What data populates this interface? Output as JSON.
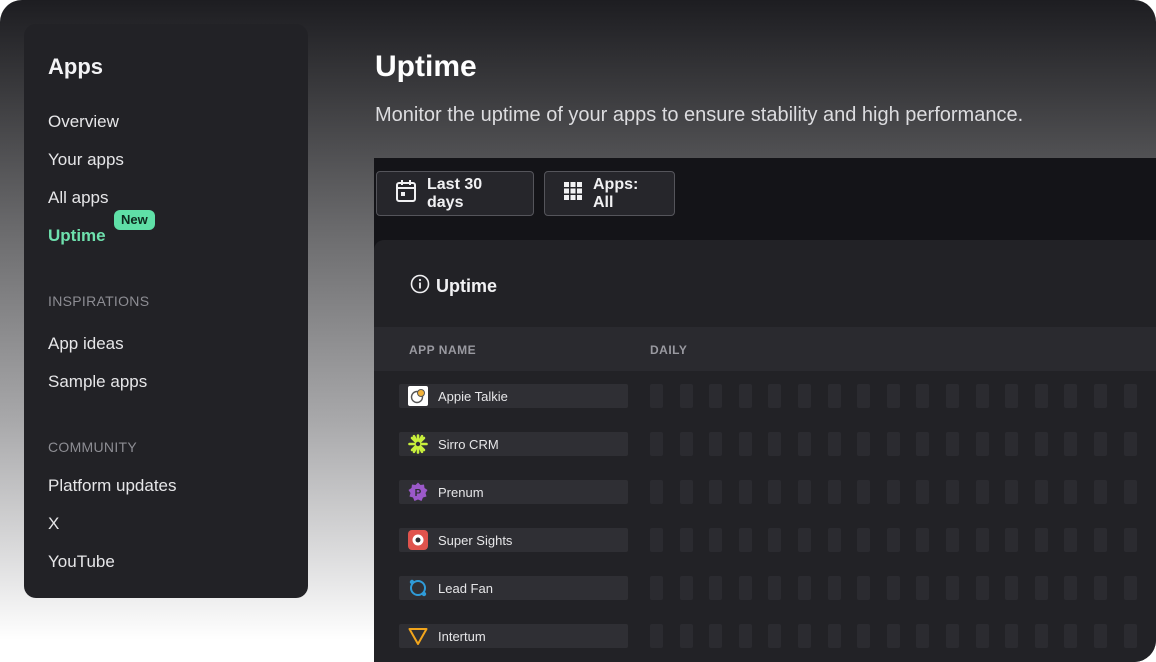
{
  "sidebar": {
    "title": "Apps",
    "items": [
      {
        "label": "Overview"
      },
      {
        "label": "Your apps"
      },
      {
        "label": "All apps"
      },
      {
        "label": "Uptime",
        "active": true,
        "badge": "New"
      }
    ],
    "sections": [
      {
        "title": "INSPIRATIONS",
        "items": [
          {
            "label": "App ideas"
          },
          {
            "label": "Sample apps"
          }
        ]
      },
      {
        "title": "COMMUNITY",
        "items": [
          {
            "label": "Platform updates"
          },
          {
            "label": "X"
          },
          {
            "label": "YouTube"
          }
        ]
      }
    ]
  },
  "main": {
    "title": "Uptime",
    "subtitle": "Monitor the uptime of your apps to ensure stability and high performance.",
    "filters": {
      "date_range": {
        "label": "Last 30 days",
        "icon": "calendar-icon"
      },
      "apps": {
        "label": "Apps: All",
        "icon": "grid-icon"
      }
    },
    "card": {
      "title": "Uptime",
      "title_icon": "info-icon",
      "columns": [
        "APP NAME",
        "DAILY"
      ],
      "rows": [
        {
          "name": "Appie Talkie",
          "logo": "appie-talkie-logo-icon"
        },
        {
          "name": "Sirro CRM",
          "logo": "sirro-crm-logo-icon"
        },
        {
          "name": "Prenum",
          "logo": "prenum-logo-icon"
        },
        {
          "name": "Super Sights",
          "logo": "super-sights-logo-icon"
        },
        {
          "name": "Lead Fan",
          "logo": "lead-fan-logo-icon"
        },
        {
          "name": "Intertum",
          "logo": "intertum-logo-icon"
        }
      ]
    }
  },
  "colors": {
    "accent_active": "#6ee0ad",
    "badge_bg": "#5fe0a7",
    "sidebar_bg": "#222226",
    "panel_bg": "#141418",
    "card_bg": "#222226"
  }
}
